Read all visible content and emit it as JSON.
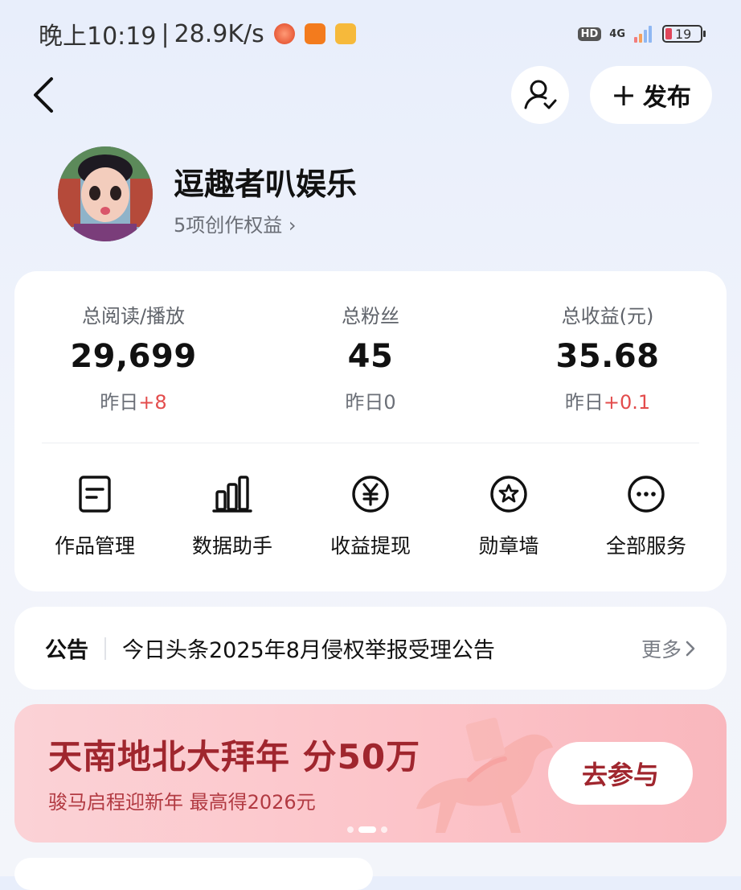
{
  "status_bar": {
    "time": "晚上10:19",
    "speed": "28.9K/s",
    "hd": "HD",
    "network": "4G",
    "battery": "19"
  },
  "nav": {
    "publish_label": "发布",
    "publish_plus": "+"
  },
  "profile": {
    "name": "逗趣者叭娱乐",
    "rights": "5项创作权益 ›"
  },
  "stats": [
    {
      "label": "总阅读/播放",
      "value": "29,699",
      "delta_prefix": "昨日",
      "delta": "+8"
    },
    {
      "label": "总粉丝",
      "value": "45",
      "delta_prefix": "昨日0",
      "delta": ""
    },
    {
      "label": "总收益(元)",
      "value": "35.68",
      "delta_prefix": "昨日",
      "delta": "+0.1"
    }
  ],
  "services": [
    {
      "label": "作品管理",
      "icon": "document-icon"
    },
    {
      "label": "数据助手",
      "icon": "bar-chart-icon"
    },
    {
      "label": "收益提现",
      "icon": "yuan-icon"
    },
    {
      "label": "勋章墙",
      "icon": "medal-icon"
    },
    {
      "label": "全部服务",
      "icon": "more-icon"
    }
  ],
  "notice": {
    "tag": "公告",
    "text": "今日头条2025年8月侵权举报受理公告",
    "more": "更多"
  },
  "banner": {
    "title": "天南地北大拜年 分50万",
    "subtitle": "骏马启程迎新年 最高得2026元",
    "button": "去参与",
    "page_count": 3,
    "active_page": 2
  },
  "colors": {
    "accent_red": "#e34c4c",
    "banner_text": "#a0262e",
    "background": "#e8eefb"
  }
}
